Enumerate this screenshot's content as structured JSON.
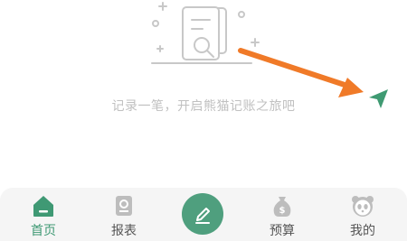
{
  "empty_state": {
    "message": "记录一笔，开启熊猫记账之旅吧"
  },
  "hint": {
    "arrow_icon": "hint-arrow",
    "send_icon": "send-icon"
  },
  "tab_bar": {
    "accent_color": "#3f9974",
    "items": [
      {
        "label": "首页",
        "icon": "home-icon",
        "active": true
      },
      {
        "label": "报表",
        "icon": "report-icon",
        "active": false
      },
      {
        "label": "",
        "icon": "edit-icon",
        "active": false
      },
      {
        "label": "预算",
        "icon": "budget-icon",
        "active": false
      },
      {
        "label": "我的",
        "icon": "panda-icon",
        "active": false
      }
    ]
  }
}
